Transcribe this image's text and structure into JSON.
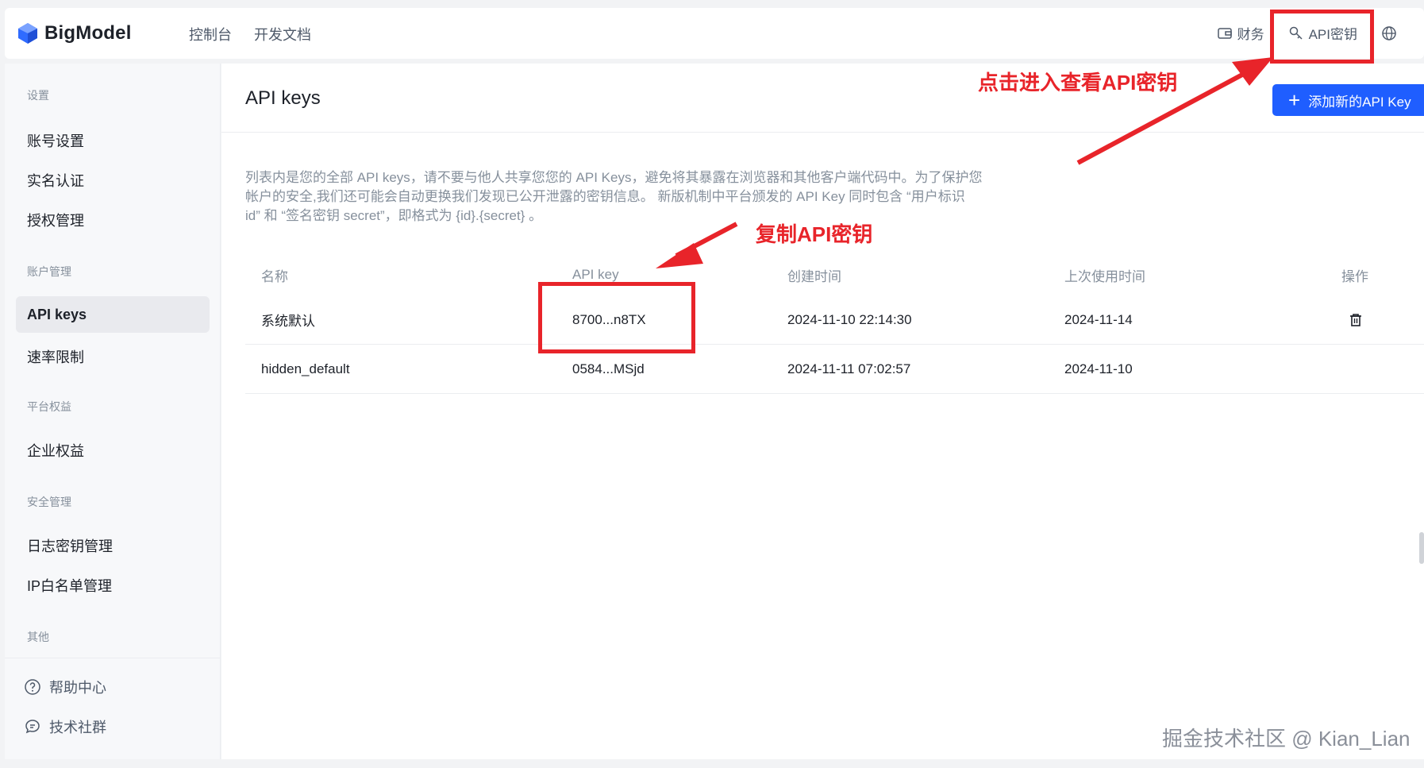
{
  "brand": {
    "name": "BigModel"
  },
  "topnav": {
    "console": "控制台",
    "docs": "开发文档"
  },
  "topright": {
    "finance": "财务",
    "api_keys": "API密钥"
  },
  "sidebar": {
    "sections": {
      "settings": "设置",
      "account": "账户管理",
      "benefits": "平台权益",
      "security": "安全管理",
      "other": "其他"
    },
    "items": {
      "account_settings": "账号设置",
      "real_name": "实名认证",
      "authorization": "授权管理",
      "api_keys": "API keys",
      "rate_limit": "速率限制",
      "enterprise": "企业权益",
      "log_key": "日志密钥管理",
      "ip_whitelist": "IP白名单管理"
    },
    "footer": {
      "help": "帮助中心",
      "community": "技术社群"
    }
  },
  "main": {
    "title": "API keys",
    "add_button": "添加新的API Key",
    "description": "列表内是您的全部 API keys，请不要与他人共享您您的 API Keys，避免将其暴露在浏览器和其他客户端代码中。为了保护您帐户的安全,我们还可能会自动更换我们发现已公开泄露的密钥信息。 新版机制中平台颁发的 API Key 同时包含 “用户标识 id” 和 “签名密钥 secret”，即格式为 {id}.{secret} 。",
    "table": {
      "headers": [
        "名称",
        "API key",
        "创建时间",
        "上次使用时间",
        "操作"
      ],
      "rows": [
        {
          "name": "系统默认",
          "key": "8700...n8TX",
          "created": "2024-11-10 22:14:30",
          "last_used": "2024-11-14"
        },
        {
          "name": "hidden_default",
          "key": "0584...MSjd",
          "created": "2024-11-11 07:02:57",
          "last_used": "2024-11-10"
        }
      ]
    }
  },
  "annotations": {
    "view_key": "点击进入查看API密钥",
    "copy_key": "复制API密钥",
    "color": "#e8242a"
  },
  "watermark": "掘金技术社区 @ Kian_Lian",
  "colors": {
    "primary": "#1f5eff",
    "annotation": "#e8242a"
  }
}
